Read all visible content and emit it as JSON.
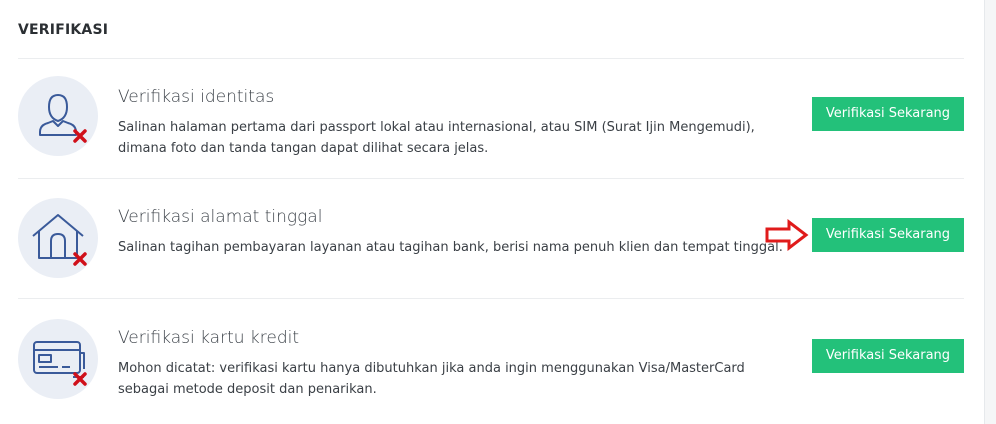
{
  "section": {
    "title": "VERIFIKASI"
  },
  "rows": [
    {
      "title": "Verifikasi identitas",
      "description": "Salinan halaman pertama dari passport lokal atau internasional, atau SIM (Surat Ijin Mengemudi), dimana foto dan tanda tangan dapat dilihat secara jelas.",
      "button_label": "Verifikasi Sekarang",
      "icon": "user-icon",
      "status": "not-verified"
    },
    {
      "title": "Verifikasi alamat tinggal",
      "description": "Salinan tagihan pembayaran layanan atau tagihan bank, berisi nama penuh klien dan tempat tinggal.",
      "button_label": "Verifikasi Sekarang",
      "icon": "house-icon",
      "status": "not-verified"
    },
    {
      "title": "Verifikasi kartu kredit",
      "description": "Mohon dicatat: verifikasi kartu hanya dibutuhkan jika anda ingin menggunakan Visa/MasterCard sebagai metode deposit dan penarikan.",
      "button_label": "Verifikasi Sekarang",
      "icon": "credit-card-icon",
      "status": "not-verified"
    }
  ],
  "colors": {
    "accent_button": "#23c17a",
    "icon_stroke": "#3a5a9a",
    "icon_background": "#eaeef5",
    "status_x": "#d0101a",
    "arrow": "#e01b1b"
  }
}
